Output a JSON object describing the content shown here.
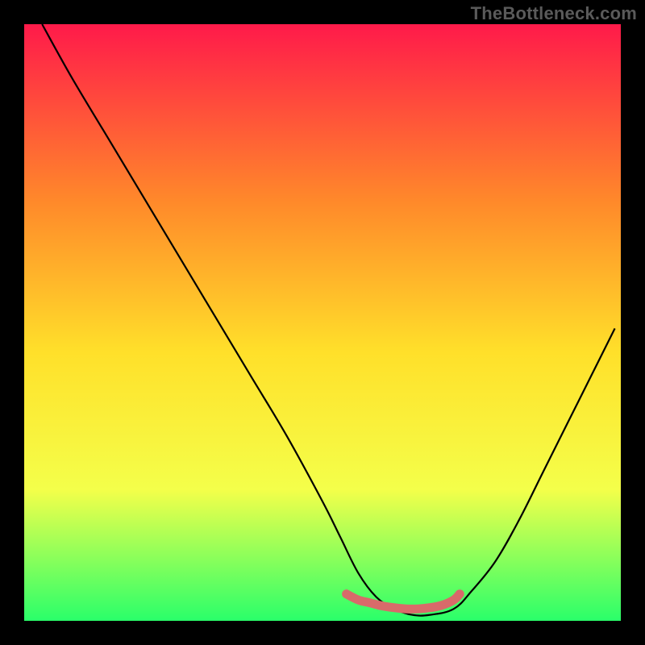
{
  "watermark": "TheBottleneck.com",
  "colors": {
    "frame": "#000000",
    "gradient_top": "#ff1a4a",
    "gradient_mid1": "#ff8a2a",
    "gradient_mid2": "#ffe02a",
    "gradient_mid3": "#f4ff4a",
    "gradient_bottom": "#2aff6a",
    "curve": "#000000",
    "marker": "#d86a6a"
  },
  "chart_data": {
    "type": "line",
    "title": "",
    "xlabel": "",
    "ylabel": "",
    "xlim": [
      0,
      100
    ],
    "ylim": [
      0,
      100
    ],
    "series": [
      {
        "name": "curve",
        "x": [
          3,
          8,
          14,
          20,
          26,
          32,
          38,
          44,
          50,
          53,
          56,
          59,
          62,
          65,
          68,
          72,
          75,
          79,
          83,
          87,
          91,
          95,
          99
        ],
        "values": [
          100,
          91,
          81,
          71,
          61,
          51,
          41,
          31,
          20,
          14,
          8,
          4,
          2,
          1,
          1,
          2,
          5,
          10,
          17,
          25,
          33,
          41,
          49
        ]
      },
      {
        "name": "highlight-band",
        "x": [
          54,
          56,
          58,
          60,
          62,
          64,
          66,
          68,
          70,
          72,
          73
        ],
        "values": [
          4.5,
          3.5,
          3.0,
          2.5,
          2.2,
          2.0,
          2.0,
          2.2,
          2.6,
          3.5,
          4.5
        ]
      }
    ]
  }
}
